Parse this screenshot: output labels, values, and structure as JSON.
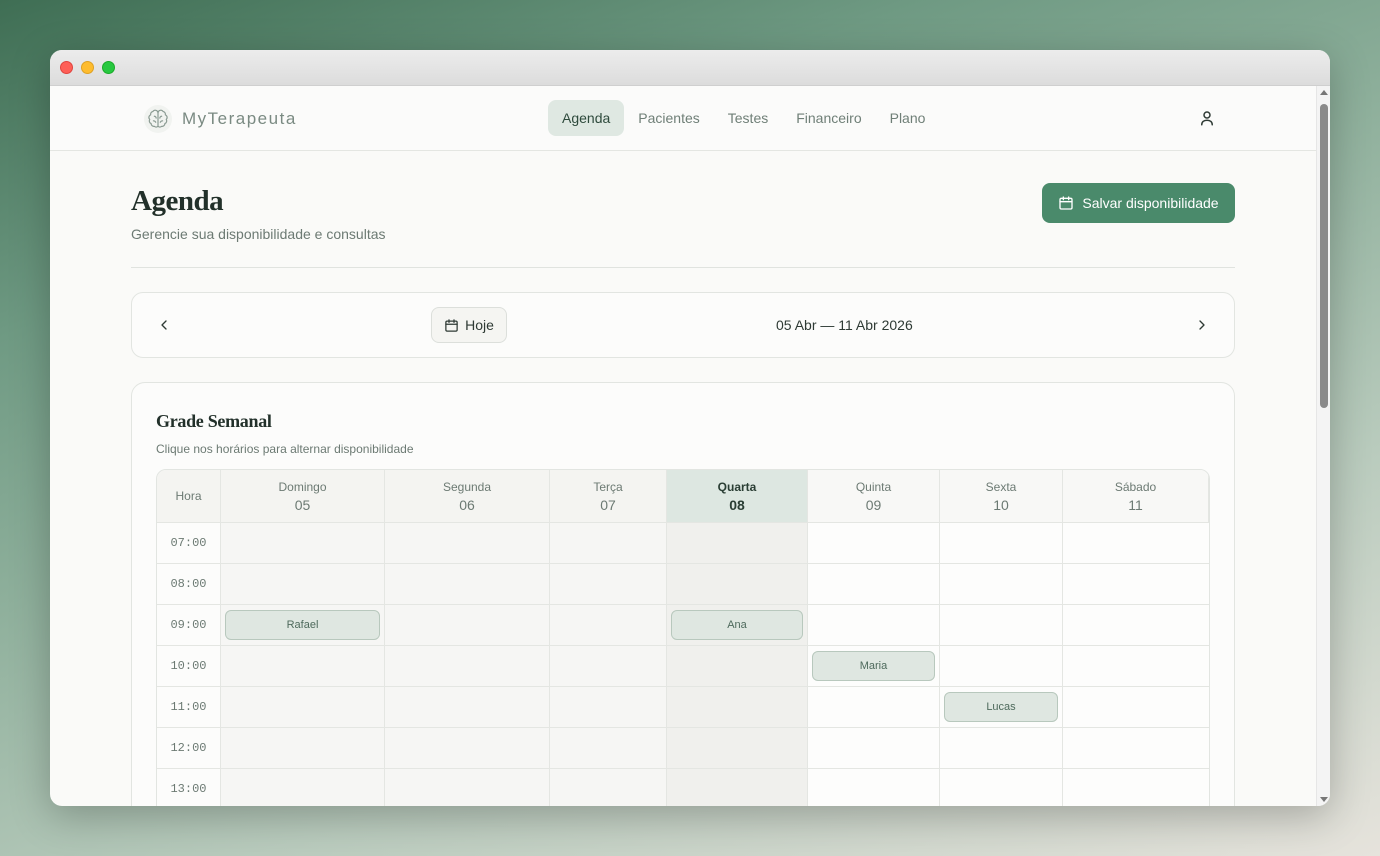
{
  "app": {
    "name": "MyTerapeuta"
  },
  "nav": {
    "items": [
      {
        "label": "Agenda",
        "active": true
      },
      {
        "label": "Pacientes",
        "active": false
      },
      {
        "label": "Testes",
        "active": false
      },
      {
        "label": "Financeiro",
        "active": false
      },
      {
        "label": "Plano",
        "active": false
      }
    ]
  },
  "page": {
    "title": "Agenda",
    "subtitle": "Gerencie sua disponibilidade e consultas",
    "save_label": "Salvar disponibilidade"
  },
  "week_nav": {
    "today_label": "Hoje",
    "range": "05 Abr — 11 Abr 2026"
  },
  "grid": {
    "title": "Grade Semanal",
    "subtitle": "Clique nos horários para alternar disponibilidade",
    "hour_header": "Hora",
    "days": [
      {
        "name": "Domingo",
        "num": "05",
        "today": false
      },
      {
        "name": "Segunda",
        "num": "06",
        "today": false
      },
      {
        "name": "Terça",
        "num": "07",
        "today": false
      },
      {
        "name": "Quarta",
        "num": "08",
        "today": true
      },
      {
        "name": "Quinta",
        "num": "09",
        "today": false
      },
      {
        "name": "Sexta",
        "num": "10",
        "today": false
      },
      {
        "name": "Sábado",
        "num": "11",
        "today": false
      }
    ],
    "hours": [
      "07:00",
      "08:00",
      "09:00",
      "10:00",
      "11:00",
      "12:00",
      "13:00"
    ],
    "appointments": [
      {
        "patient": "Rafael",
        "day": 0,
        "hour": 2
      },
      {
        "patient": "Ana",
        "day": 3,
        "hour": 2
      },
      {
        "patient": "Maria",
        "day": 4,
        "hour": 3
      },
      {
        "patient": "Lucas",
        "day": 5,
        "hour": 4
      }
    ]
  },
  "colors": {
    "accent": "#4a8a6b",
    "active_nav_bg": "#dfe8e2",
    "today_header_bg": "#dde7e1",
    "appointment_bg": "#dfe7e1"
  }
}
